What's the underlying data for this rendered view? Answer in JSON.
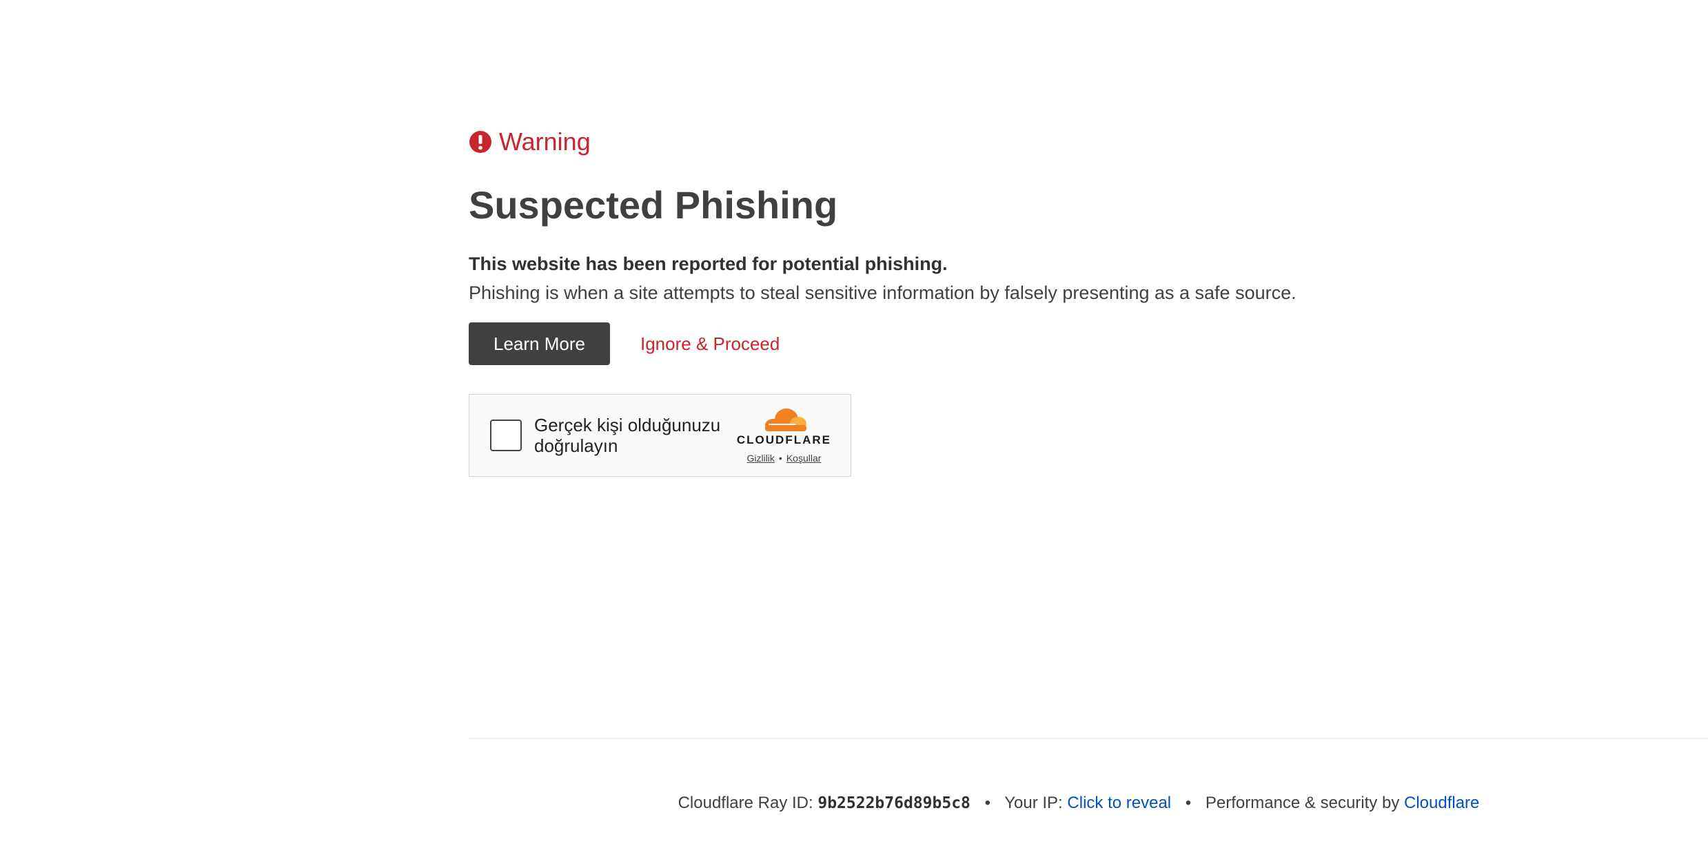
{
  "warning": {
    "label": "Warning",
    "icon": "exclamation-circle-icon",
    "color": "#c8252c"
  },
  "title": "Suspected Phishing",
  "lead": "This website has been reported for potential phishing.",
  "description": "Phishing is when a site attempts to steal sensitive information by falsely presenting as a safe source.",
  "actions": {
    "learn_more": "Learn More",
    "ignore_proceed": "Ignore & Proceed"
  },
  "turnstile": {
    "label": "Gerçek kişi olduğunuzu doğrulayın",
    "brand": "CLOUDFLARE",
    "privacy": "Gizlilik",
    "separator": "•",
    "terms": "Koşullar",
    "accent": "#f38020"
  },
  "footer": {
    "ray_label": "Cloudflare Ray ID:",
    "ray_id": "9b2522b76d89b5c8",
    "separator": "•",
    "ip_label": "Your IP:",
    "ip_link": "Click to reveal",
    "perf_label": "Performance & security by",
    "cf_link": "Cloudflare",
    "link_color": "#0051c3"
  }
}
